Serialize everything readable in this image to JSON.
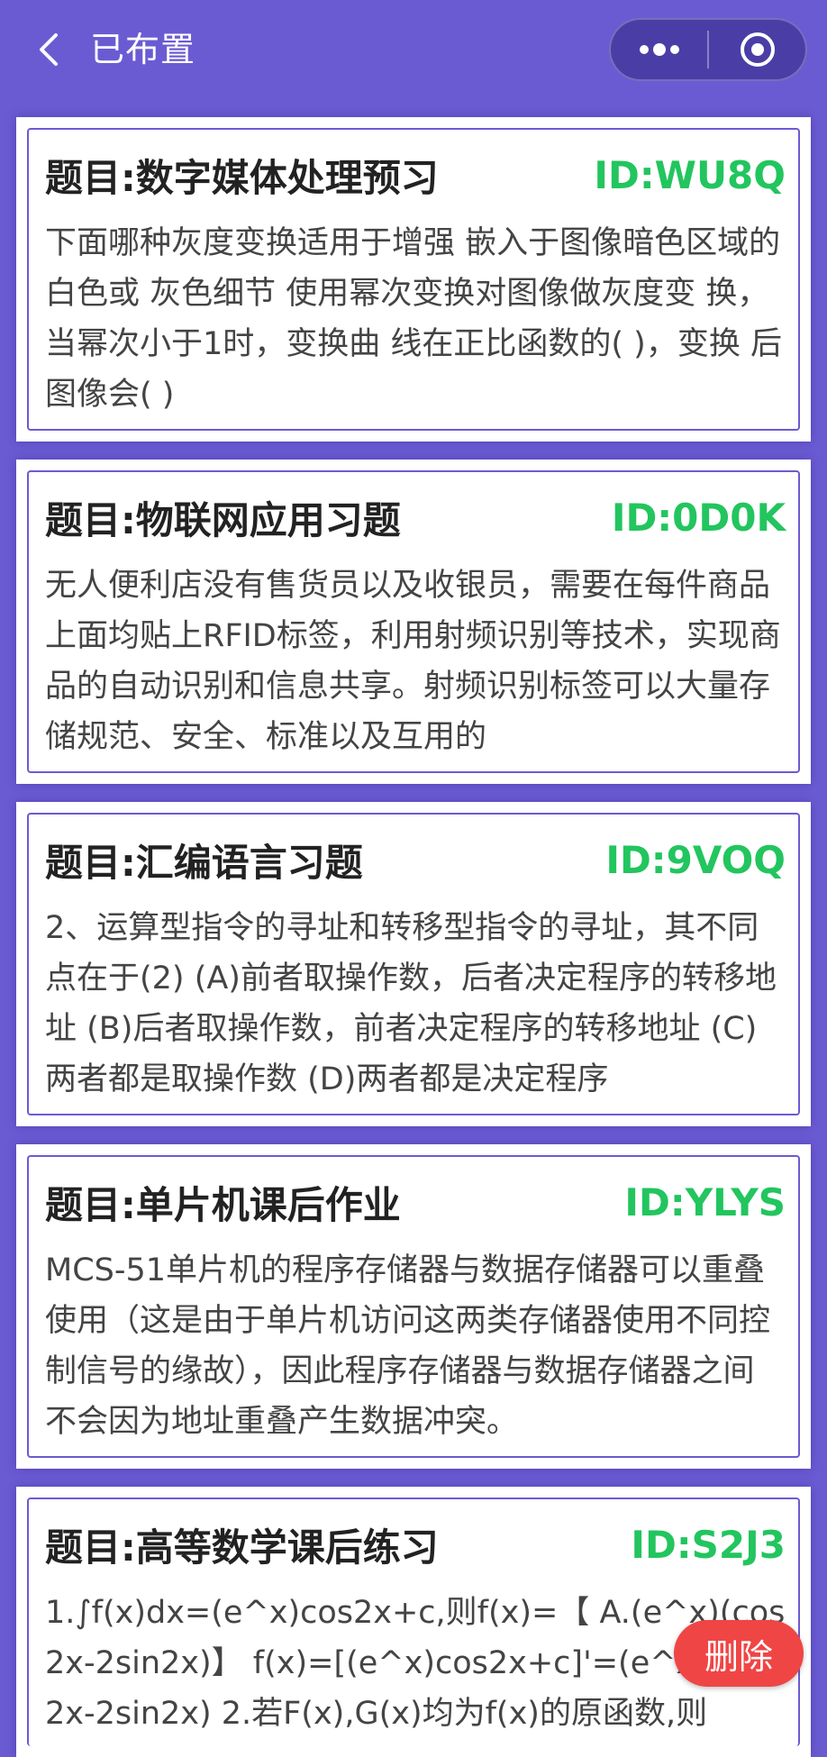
{
  "header": {
    "title": "已布置",
    "back_icon": "chevron-left-icon",
    "more_icon": "more-dots-icon",
    "close_icon": "target-circle-icon"
  },
  "cards": [
    {
      "title": "题目:数字媒体处理预习",
      "id": "ID:WU8Q",
      "body": "下面哪种灰度变换适用于增强 嵌入于图像暗色区域的白色或 灰色细节 使用幂次变换对图像做灰度变 换，当幂次小于1时，变换曲 线在正比函数的( )，变换 后图像会( )"
    },
    {
      "title": "题目:物联网应用习题",
      "id": "ID:0D0K",
      "body": "无人便利店没有售货员以及收银员，需要在每件商品上面均贴上RFID标签，利用射频识别等技术，实现商品的自动识别和信息共享。射频识别标签可以大量存储规范、安全、标准以及互用的"
    },
    {
      "title": "题目:汇编语言习题",
      "id": "ID:9VOQ",
      "body": "2、运算型指令的寻址和转移型指令的寻址，其不同点在于(2) (A)前者取操作数，后者决定程序的转移地址 (B)后者取操作数，前者决定程序的转移地址 (C)两者都是取操作数 (D)两者都是决定程序"
    },
    {
      "title": "题目:单片机课后作业",
      "id": "ID:YLYS",
      "body": "MCS-51单片机的程序存储器与数据存储器可以重叠使用（这是由于单片机访问这两类存储器使用不同控制信号的缘故），因此程序存储器与数据存储器之间不会因为地址重叠产生数据冲突。"
    },
    {
      "title": "题目:高等数学课后练习",
      "id": "ID:S2J3",
      "body": "1.∫f(x)dx=(e^x)cos2x+c,则f(x)=【 A.(e^x)(cos2x-2sin2x)】 f(x)=[(e^x)cos2x+c]'=(e^x)(cos2x-2sin2x) 2.若F(x),G(x)均为f(x)的原函数,则"
    }
  ],
  "delete_label": "删除",
  "colors": {
    "background": "#6b5bd3",
    "id_green": "#22c55e",
    "delete_red": "#f04545"
  }
}
